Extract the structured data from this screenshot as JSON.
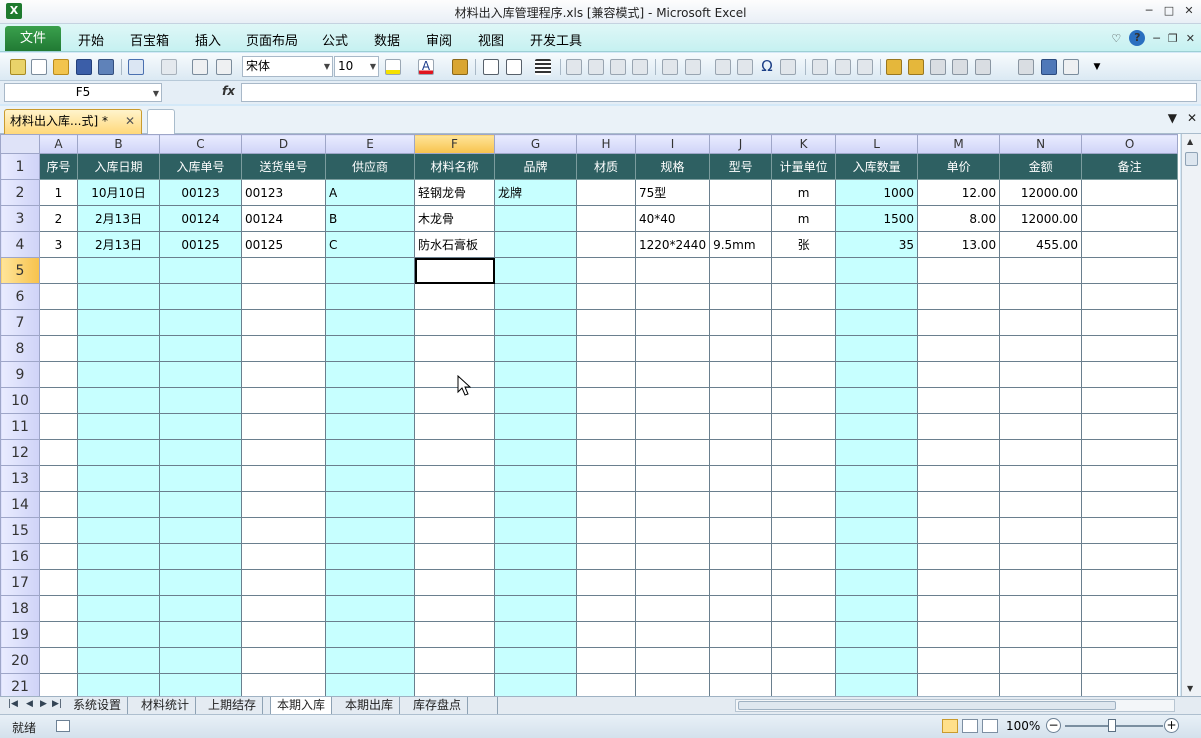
{
  "window": {
    "title": "材料出入库管理程序.xls  [兼容模式] - Microsoft Excel",
    "app_icon": "X",
    "controls": [
      "─",
      "□",
      "✕"
    ]
  },
  "ribbon": {
    "file_tab": "文件",
    "tabs": [
      "开始",
      "百宝箱",
      "插入",
      "页面布局",
      "公式",
      "数据",
      "审阅",
      "视图",
      "开发工具"
    ],
    "right_icons": [
      "♡",
      "?",
      "─",
      "❐",
      "✕"
    ]
  },
  "toolbar": {
    "font_name": "宋体",
    "font_size": "10",
    "font_color_letter": "A"
  },
  "formula_bar": {
    "name_box": "F5",
    "fx_label": "fx",
    "formula": ""
  },
  "workbook_tabs": {
    "active_label": "材料出入库...式] *",
    "close": "✕",
    "right_controls": [
      "▼",
      "✕"
    ]
  },
  "grid": {
    "columns": [
      "A",
      "B",
      "C",
      "D",
      "E",
      "F",
      "G",
      "H",
      "I",
      "J",
      "K",
      "L",
      "M",
      "N",
      "O"
    ],
    "selected_column": "F",
    "selected_row": "5",
    "row_numbers": [
      "1",
      "2",
      "3",
      "4",
      "5",
      "6",
      "7",
      "8",
      "9",
      "10",
      "11",
      "12",
      "13",
      "14",
      "15",
      "16",
      "17",
      "18",
      "19",
      "20",
      "21"
    ],
    "header_row": [
      "序号",
      "入库日期",
      "入库单号",
      "送货单号",
      "供应商",
      "材料名称",
      "品牌",
      "材质",
      "规格",
      "型号",
      "计量单位",
      "入库数量",
      "单价",
      "金额",
      "备注"
    ],
    "data_rows": [
      [
        "1",
        "10月10日",
        "00123",
        "00123",
        "A",
        "轻钢龙骨",
        "龙牌",
        "",
        "75型",
        "",
        "m",
        "1000",
        "12.00",
        "12000.00",
        ""
      ],
      [
        "2",
        "2月13日",
        "00124",
        "00124",
        "B",
        "木龙骨",
        "",
        "",
        "40*40",
        "",
        "m",
        "1500",
        "8.00",
        "12000.00",
        ""
      ],
      [
        "3",
        "2月13日",
        "00125",
        "00125",
        "C",
        "防水石膏板",
        "",
        "",
        "1220*2440",
        "9.5mm",
        "张",
        "35",
        "13.00",
        "455.00",
        ""
      ]
    ]
  },
  "sheet_tabs": {
    "nav": [
      "|◀",
      "◀",
      "▶",
      "▶|"
    ],
    "tabs": [
      "系统设置",
      "材料统计",
      "上期结存",
      "本期入库",
      "本期出库",
      "库存盘点"
    ],
    "active": "本期入库"
  },
  "status_bar": {
    "status": "就绪",
    "zoom": "100%",
    "zoom_minus": "−",
    "zoom_plus": "+"
  },
  "colors": {
    "header_fill": "#2e6062",
    "cyan_fill": "#c7ffff",
    "ribbon_bg": "#c6f1f1",
    "file_tab": "#2a8a3c"
  }
}
